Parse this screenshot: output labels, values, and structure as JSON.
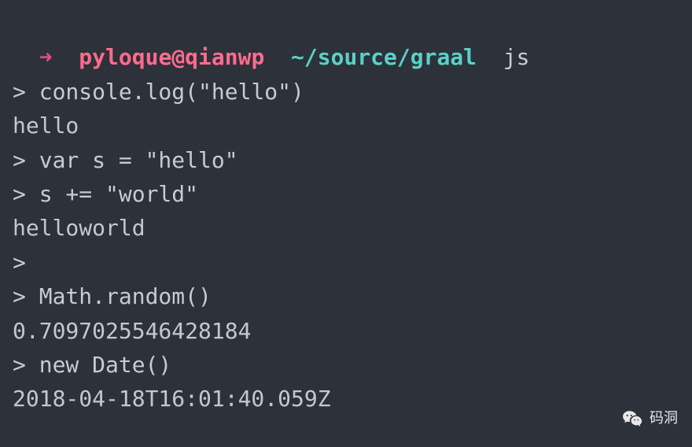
{
  "header": {
    "arrow": "➜",
    "user_host": "pyloque@qianwp",
    "path": "~/source/graal",
    "command": "js"
  },
  "lines": [
    {
      "prompt": "> ",
      "input": "console.log(\"hello\")"
    },
    {
      "output": "hello"
    },
    {
      "prompt": "> ",
      "input": "var s = \"hello\""
    },
    {
      "prompt": "> ",
      "input": "s += \"world\""
    },
    {
      "output": "helloworld"
    },
    {
      "prompt": "> ",
      "input": ""
    },
    {
      "prompt": "> ",
      "input": "Math.random()"
    },
    {
      "output": "0.7097025546428184"
    },
    {
      "prompt": "> ",
      "input": "new Date()"
    },
    {
      "output": "2018-04-18T16:01:40.059Z"
    }
  ],
  "watermark": {
    "label": "码洞"
  }
}
